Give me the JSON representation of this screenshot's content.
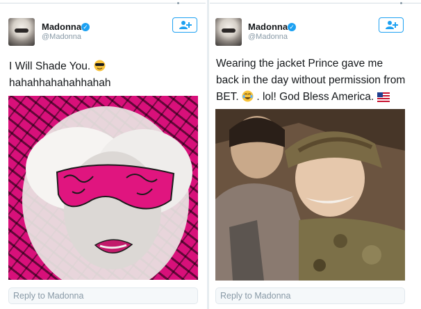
{
  "left_tweet": {
    "author": {
      "name": "Madonna",
      "handle": "@Madonna",
      "verified": true
    },
    "text_lines": [
      "I Will Shade You.",
      "hahahhahahahhahah"
    ],
    "emoji": "smiling-face-with-sunglasses",
    "reply_placeholder": "Reply to Madonna"
  },
  "right_tweet": {
    "author": {
      "name": "Madonna",
      "handle": "@Madonna",
      "verified": true
    },
    "text_lines": [
      "Wearing the jacket Prince gave me",
      "back in the day without permission from",
      "BET.",
      ". lol! God Bless America."
    ],
    "emojis": [
      "face-with-tears-of-joy",
      "us-flag"
    ],
    "reply_placeholder": "Reply to Madonna"
  },
  "colors": {
    "accent": "#1da1f2",
    "text": "#14171a",
    "muted": "#8899a6",
    "left_photo_pink": "#d8107a"
  },
  "icons": {
    "verified": "verified-badge-icon",
    "follow": "follow-user-icon"
  }
}
